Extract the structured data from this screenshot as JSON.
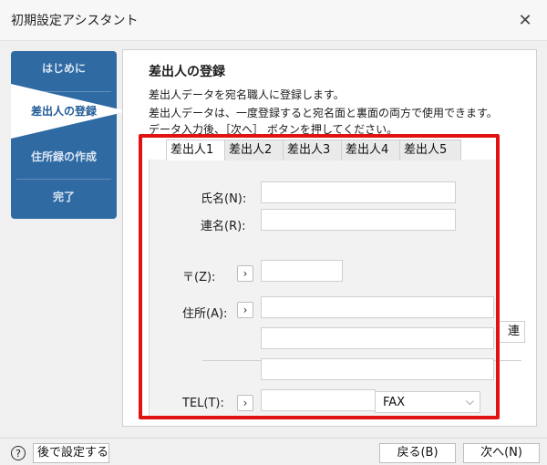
{
  "window": {
    "title": "初期設定アシスタント",
    "close_glyph": "✕"
  },
  "nav": {
    "items": [
      {
        "label": "はじめに"
      },
      {
        "label": "差出人の登録"
      },
      {
        "label": "住所録の作成"
      },
      {
        "label": "完了"
      }
    ]
  },
  "content": {
    "heading": "差出人の登録",
    "lines": [
      "差出人データを宛名職人に登録します。",
      "差出人データは、一度登録すると宛名面と裏面の両方で使用できます。",
      "データ入力後、［次へ］ ボタンを押してください。"
    ]
  },
  "tabs": [
    "差出人1",
    "差出人2",
    "差出人3",
    "差出人4",
    "差出人5"
  ],
  "form": {
    "name_label": "氏名(N):",
    "renmei_label": "連名(R):",
    "renmei_button": "連",
    "postal_label": "〒(Z):",
    "address_label": "住所(A):",
    "tel_label": "TEL(T):",
    "expand_glyph": "›",
    "select": {
      "value": "FAX",
      "chevron": "⌵"
    }
  },
  "footer": {
    "help_glyph": "?",
    "help_label": "後で設定する",
    "back_label": "戻る(B)",
    "next_label": "次へ(N)"
  },
  "colors": {
    "nav_bg": "#2f6aa3",
    "nav_active_text": "#1f5b95",
    "highlight": "#e01212"
  }
}
